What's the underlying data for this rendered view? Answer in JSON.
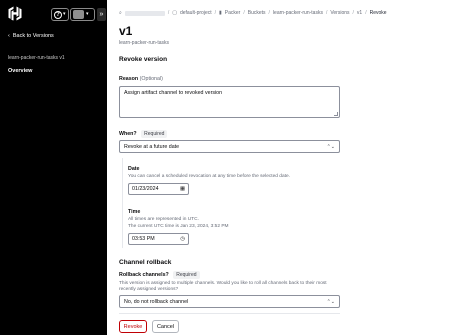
{
  "sidebar": {
    "logo_icon": "hashicorp-logo-icon",
    "help_icon": "help-icon",
    "back_label": "Back to Versions",
    "context_label": "learn-packer-run-tasks  v1",
    "nav_overview": "Overview"
  },
  "breadcrumb": {
    "items": [
      "default-project",
      "Packer",
      "Buckets",
      "learn-packer-run-tasks",
      "Versions",
      "v1",
      "Revoke"
    ]
  },
  "page": {
    "title": "v1",
    "subtitle": "learn-packer-run-tasks"
  },
  "revoke_section": {
    "title": "Revoke version",
    "reason_label": "Reason",
    "reason_optional": "(Optional)",
    "reason_value": "Assign artifact channel to revoked version",
    "when_label": "When?",
    "required_badge": "Required",
    "when_value": "Revoke at a future date",
    "date_label": "Date",
    "date_helper": "You can cancel a scheduled revocation at any time before the selected date.",
    "date_value": "01/23/2024",
    "time_label": "Time",
    "time_helper_1": "All times are represented in UTC.",
    "time_helper_2": "The current UTC time is Jan 23, 2024, 3:52 PM",
    "time_value": "03:53 PM"
  },
  "rollback_section": {
    "title": "Channel rollback",
    "label": "Rollback channels?",
    "required_badge": "Required",
    "helper_1": "This version is assigned to multiple channels. Would you like to roll all channels back to their most",
    "helper_2": "recently assigned versions?",
    "value": "No, do not rollback channel"
  },
  "actions": {
    "revoke_label": "Revoke",
    "cancel_label": "Cancel"
  },
  "colors": {
    "sidebar_bg": "#000000",
    "danger": "#c00005",
    "border": "#8c909c"
  }
}
